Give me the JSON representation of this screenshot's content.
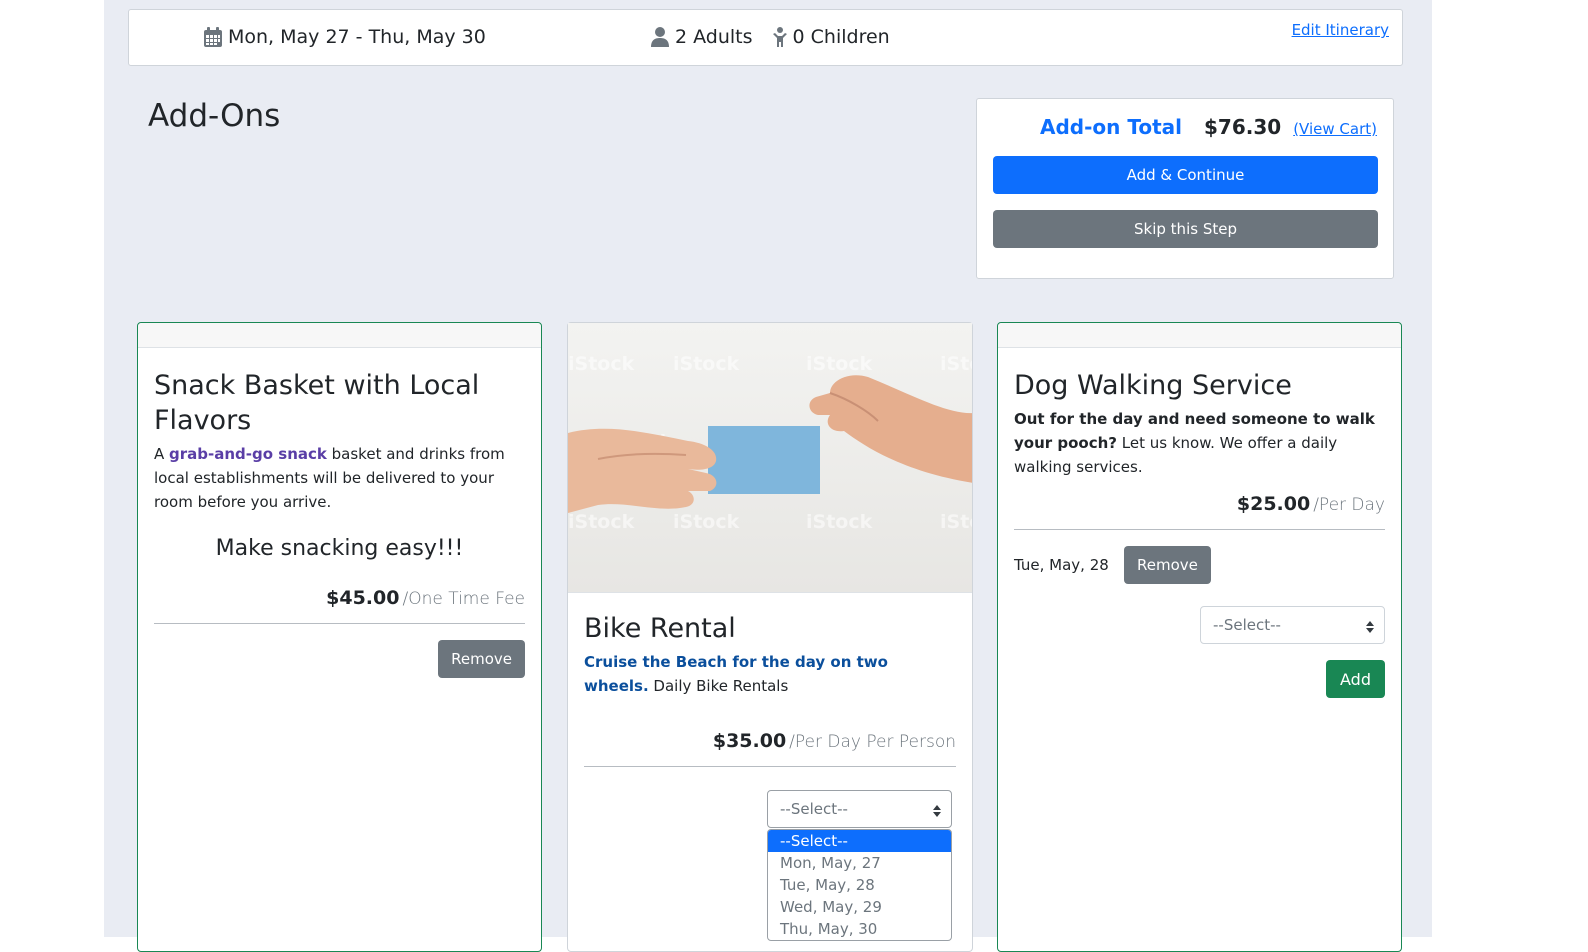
{
  "itinerary": {
    "dates": "Mon, May 27 - Thu, May 30",
    "adults": "2 Adults",
    "children": "0 Children",
    "edit_link": "Edit Itinerary"
  },
  "page": {
    "title": "Add-Ons"
  },
  "summary": {
    "label": "Add-on Total",
    "amount": "$76.30",
    "view_cart": "(View Cart)",
    "primary_button": "Add & Continue",
    "secondary_button": "Skip this Step"
  },
  "cards": [
    {
      "title": "Snack Basket with Local Flavors",
      "desc_link": "grab-and-go snack",
      "desc_prefix": "A ",
      "desc_suffix": " basket and drinks from local establishments will be delivered to your room before you arrive.",
      "tagline": "Make snacking easy!!!",
      "price": "$45.00",
      "unit": "/One Time Fee",
      "remove_label": "Remove"
    },
    {
      "title": "Bike Rental",
      "desc_link": "Cruise the Beach for the day on two wheels.",
      "desc_suffix": " Daily Bike Rentals",
      "price": "$35.00",
      "unit": "/Per Day Per Person",
      "image_watermark": "iStock",
      "select": {
        "value": "--Select--",
        "options": [
          "--Select--",
          "Mon, May, 27",
          "Tue, May, 28",
          "Wed, May, 29",
          "Thu, May, 30"
        ],
        "selected_index": 0
      }
    },
    {
      "title": "Dog Walking Service",
      "desc_bold": "Out for the day and need someone to walk your pooch?",
      "desc_suffix": " Let us know. We offer a daily walking services.",
      "price": "$25.00",
      "unit": "/Per Day",
      "booked_date": "Tue, May, 28",
      "remove_label": "Remove",
      "select_value": "--Select--",
      "add_label": "Add"
    }
  ],
  "colors": {
    "primary": "#0d6efd",
    "secondary": "#6c757d",
    "success": "#198754",
    "background": "#e9ecf3"
  }
}
